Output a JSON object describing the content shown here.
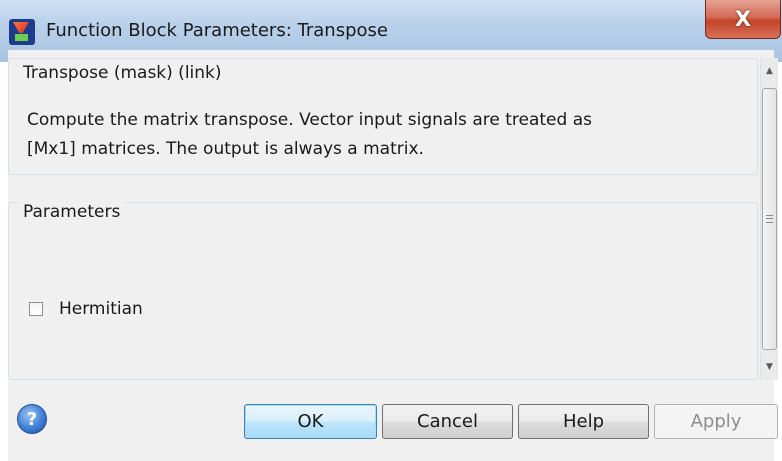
{
  "window": {
    "title": "Function Block Parameters: Transpose",
    "close_glyph": "X",
    "app_icon": "simulink-block-icon"
  },
  "description_group": {
    "title": "Transpose (mask) (link)",
    "text_line1": "Compute the matrix transpose.  Vector input signals are treated as",
    "text_line2": "[Mx1] matrices. The output is always a matrix."
  },
  "parameters_group": {
    "title": "Parameters",
    "hermitian_label": "Hermitian",
    "hermitian_checked": false
  },
  "buttons": {
    "help_icon": "?",
    "ok": "OK",
    "cancel": "Cancel",
    "help": "Help",
    "apply": "Apply",
    "apply_enabled": false
  },
  "colors": {
    "close_button": "#c34329",
    "ok_accent": "#3c7fb1",
    "dialog_bg": "#f0f0f0"
  }
}
